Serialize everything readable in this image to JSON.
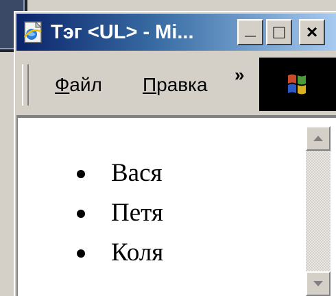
{
  "window": {
    "title": "Тэг <UL> - Mi...",
    "minimize_glyph": "_",
    "maximize_glyph": "□",
    "close_glyph": "×"
  },
  "menu": {
    "items": [
      {
        "label_first": "Ф",
        "label_rest": "айл"
      },
      {
        "label_first": "П",
        "label_rest": "равка"
      }
    ],
    "overflow_glyph": "»"
  },
  "content": {
    "list": [
      "Вася",
      "Петя",
      "Коля"
    ]
  },
  "icons": {
    "app": "browser-page-icon",
    "throbber": "windows-logo-icon",
    "scroll_up": "triangle-up-icon",
    "scroll_down": "triangle-down-icon"
  },
  "colors": {
    "titlebar_start": "#0a246a",
    "titlebar_end": "#a6caf0",
    "face": "#d4d0c8",
    "content_bg": "#ffffff"
  }
}
